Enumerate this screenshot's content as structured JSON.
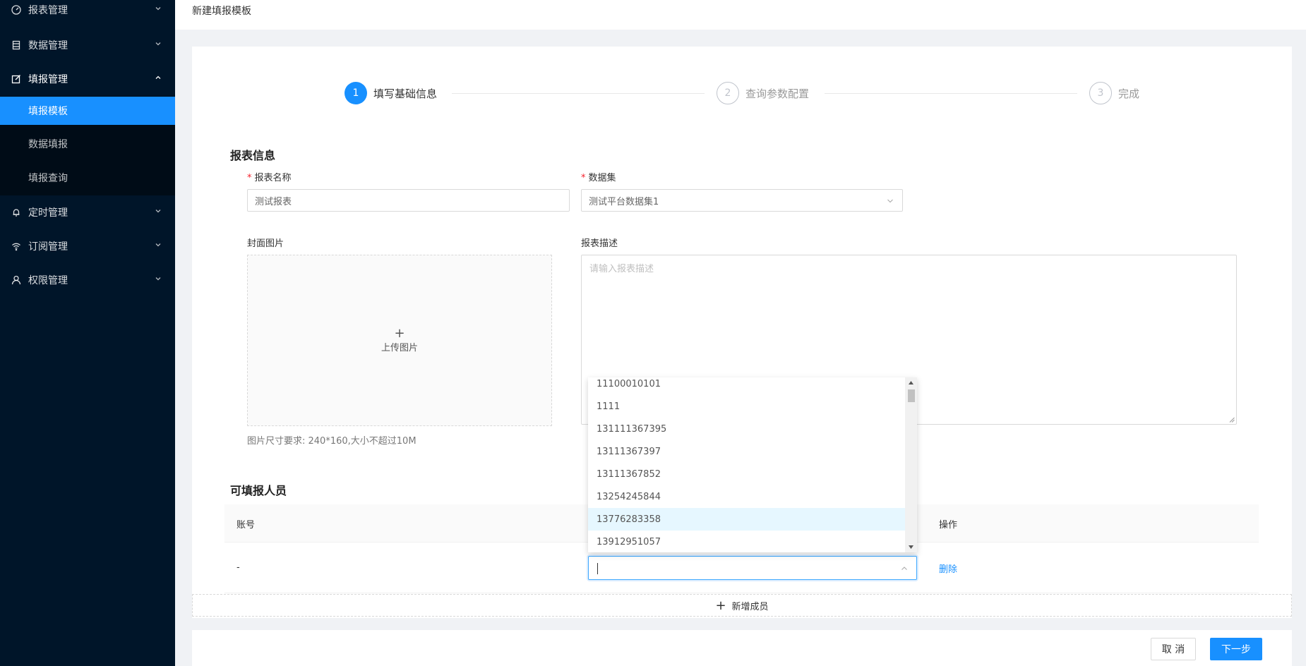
{
  "sidebar": {
    "items": [
      {
        "label": "报表管理",
        "icon": "dashboard-icon"
      },
      {
        "label": "数据管理",
        "icon": "database-icon"
      },
      {
        "label": "填报管理",
        "icon": "edit-icon"
      },
      {
        "label": "定时管理",
        "icon": "bell-icon"
      },
      {
        "label": "订阅管理",
        "icon": "wifi-icon"
      },
      {
        "label": "权限管理",
        "icon": "user-icon"
      }
    ],
    "submenu": [
      {
        "label": "填报模板"
      },
      {
        "label": "数据填报"
      },
      {
        "label": "填报查询"
      }
    ]
  },
  "header": {
    "title": "新建填报模板"
  },
  "steps": [
    {
      "num": "1",
      "label": "填写基础信息",
      "status": "active"
    },
    {
      "num": "2",
      "label": "查询参数配置",
      "status": "wait"
    },
    {
      "num": "3",
      "label": "完成",
      "status": "wait"
    }
  ],
  "report_info": {
    "section_title": "报表信息",
    "name_label": "报表名称",
    "name_value": "测试报表",
    "dataset_label": "数据集",
    "dataset_value": "测试平台数据集1",
    "cover_label": "封面图片",
    "upload_plus": "+",
    "upload_text": "上传图片",
    "upload_hint": "图片尺寸要求: 240*160,大小不超过10M",
    "desc_label": "报表描述",
    "desc_placeholder": "请输入报表描述"
  },
  "members": {
    "section_title": "可填报人员",
    "columns": {
      "account": "账号",
      "action": "操作"
    },
    "rows": [
      {
        "account": "-",
        "action": "删除"
      }
    ],
    "add_label": "新增成员",
    "add_plus": "+"
  },
  "dropdown": {
    "options": [
      "11100010101",
      "1111",
      "131111367395",
      "13111367397",
      "13111367852",
      "13254245844",
      "13776283358",
      "13912951057"
    ],
    "highlighted": "13776283358"
  },
  "footer": {
    "cancel_label": "取 消",
    "next_label": "下一步"
  },
  "colors": {
    "primary": "#1890ff",
    "sidebar_bg": "#001529",
    "submenu_bg": "#000c17",
    "danger": "#f5222d"
  }
}
